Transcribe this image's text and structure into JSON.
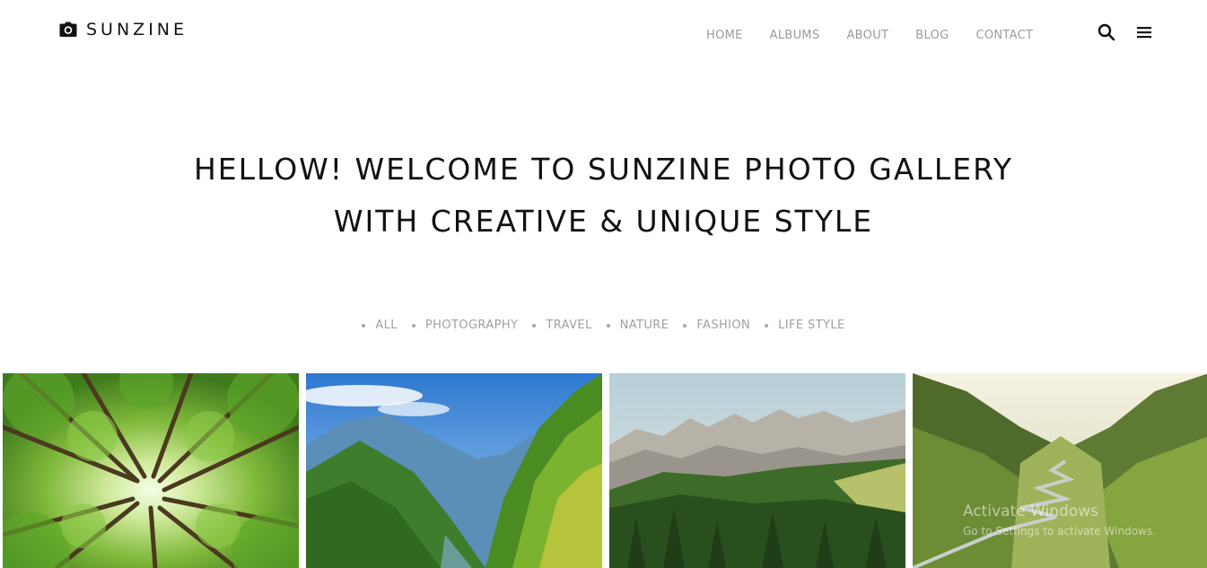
{
  "brand": {
    "name": "SUNZINE",
    "icon": "camera-icon"
  },
  "nav": {
    "items": [
      {
        "label": "HOME"
      },
      {
        "label": "ALBUMS"
      },
      {
        "label": "ABOUT"
      },
      {
        "label": "BLOG"
      },
      {
        "label": "CONTACT"
      }
    ]
  },
  "header_icons": {
    "search": "search-icon",
    "menu": "menu-icon"
  },
  "hero": {
    "line1": "HELLOW! WELCOME TO SUNZINE PHOTO GALLERY",
    "line2": "WITH CREATIVE & UNIQUE STYLE"
  },
  "filters": [
    {
      "label": "ALL"
    },
    {
      "label": "PHOTOGRAPHY"
    },
    {
      "label": "TRAVEL"
    },
    {
      "label": "NATURE"
    },
    {
      "label": "FASHION"
    },
    {
      "label": "LIFE STYLE"
    }
  ],
  "gallery": [
    {
      "subject": "forest canopy looking up"
    },
    {
      "subject": "mountain valley with blue sky"
    },
    {
      "subject": "rocky peaks above pine forest"
    },
    {
      "subject": "winding mountain road"
    }
  ],
  "watermark": {
    "title": "Activate Windows",
    "subtitle": "Go to Settings to activate Windows."
  },
  "colors": {
    "text_dark": "#111111",
    "nav_gray": "#9a9a9a",
    "filter_gray": "#a0a0a0",
    "background": "#ffffff"
  }
}
